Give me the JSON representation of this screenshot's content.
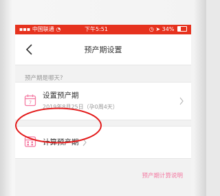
{
  "status_bar": {
    "carrier": "中国联通",
    "time": "下午5:51",
    "battery": "34%"
  },
  "nav": {
    "title": "预产期设置"
  },
  "section_label": "预产期是哪天?",
  "set_due_date": {
    "title": "设置预产期",
    "subtitle": "2019年8月25日（孕0周4天）"
  },
  "calc_due_date": {
    "title": "计算预产期"
  },
  "help_link": "预产期计算说明",
  "colors": {
    "status_bar": "#e6321e",
    "accent_pink": "#f47aa2",
    "annotation_red": "#e31b1b"
  },
  "icons": {
    "back": "chevron-left-icon",
    "calendar": "calendar-icon",
    "calculator": "calculator-icon",
    "chevron": "chevron-right-icon"
  }
}
